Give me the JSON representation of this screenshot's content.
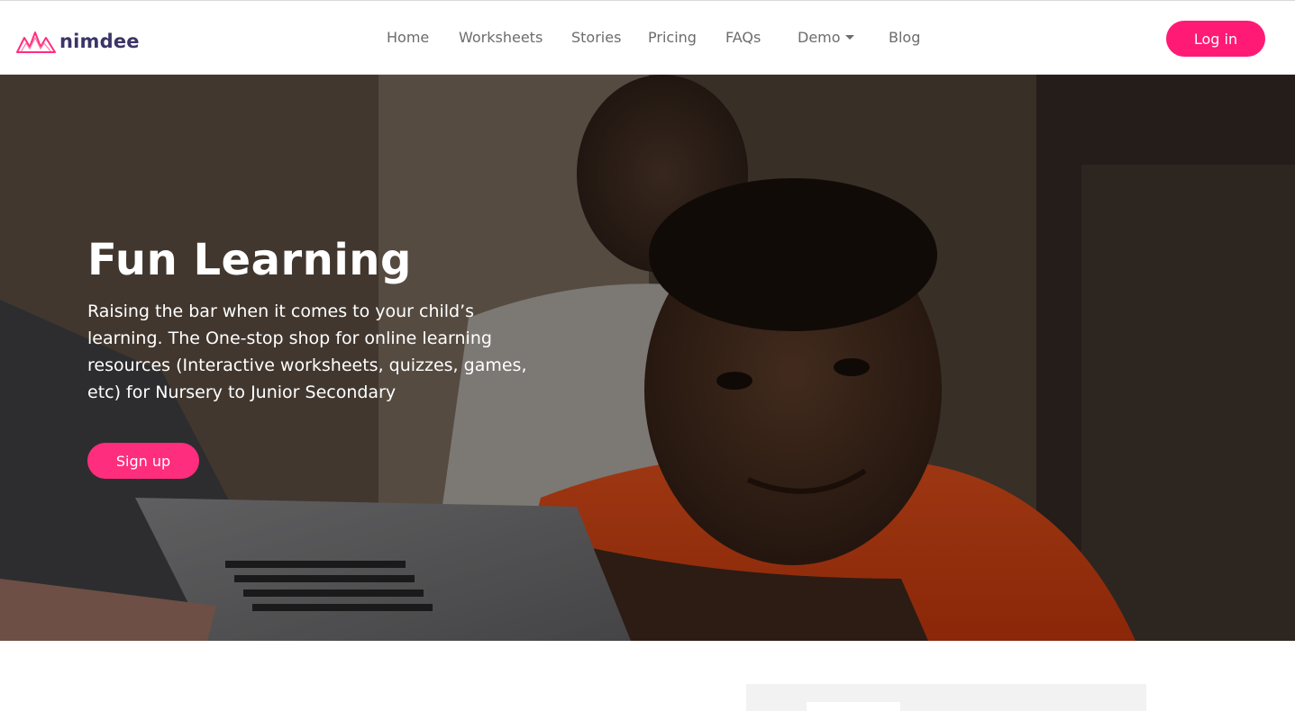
{
  "brand": {
    "name": "nimdee",
    "logo_icon": "crown-icon",
    "accent": "#ff1a75"
  },
  "nav": {
    "items": [
      {
        "label": "Home"
      },
      {
        "label": "Worksheets"
      },
      {
        "label": "Stories"
      },
      {
        "label": "Pricing"
      },
      {
        "label": "FAQs"
      },
      {
        "label": "Demo",
        "has_dropdown": true
      },
      {
        "label": "Blog"
      }
    ],
    "login_label": "Log in"
  },
  "hero": {
    "title": "Fun Learning",
    "subtitle": "Raising the bar when it comes to your child’s learning. The One-stop shop for online learning resources (Interactive worksheets, quizzes, games, etc) for Nursery to Junior Secondary",
    "signup_label": "Sign up",
    "image_subject": "smiling boy at laptop with adult in background"
  }
}
